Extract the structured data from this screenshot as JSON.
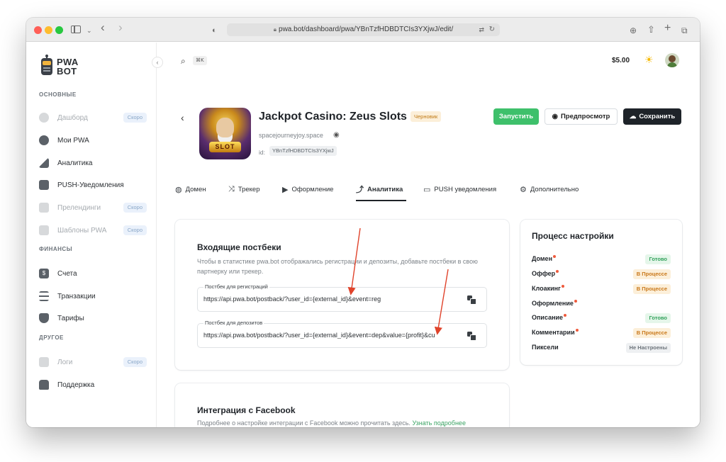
{
  "browser": {
    "url": "pwa.bot/dashboard/pwa/YBnTzfHDBDTCIs3YXjwJ/edit/"
  },
  "sidebar": {
    "logo_text_1": "PWA",
    "logo_text_2": "BOT",
    "sections": [
      {
        "title": "ОСНОВНЫЕ"
      },
      {
        "title": "ФИНАНСЫ"
      },
      {
        "title": "ДРУГОЕ"
      }
    ],
    "items": [
      {
        "label": "Дашборд",
        "badge": "Скоро"
      },
      {
        "label": "Мои PWA"
      },
      {
        "label": "Аналитика"
      },
      {
        "label": "PUSH-Уведомления"
      },
      {
        "label": "Прелендинги",
        "badge": "Скоро"
      },
      {
        "label": "Шаблоны PWA",
        "badge": "Скоро"
      },
      {
        "label": "Счета"
      },
      {
        "label": "Транзакции"
      },
      {
        "label": "Тарифы"
      },
      {
        "label": "Логи",
        "badge": "Скоро"
      },
      {
        "label": "Поддержка"
      }
    ]
  },
  "header": {
    "shortcut": "⌘K",
    "balance": "$5.00"
  },
  "app": {
    "title": "Jackpot Casino: Zeus Slots",
    "status_badge": "Черновик",
    "domain": "spacejourneyjoy.space",
    "id_label": "id:",
    "id_value": "YBnTzfHDBDTCIs3YXjwJ",
    "icon_text": "SLOT"
  },
  "actions": {
    "launch": "Запустить",
    "preview": "Предпросмотр",
    "save": "Сохранить"
  },
  "tabs": [
    {
      "label": "Домен",
      "icon": "globe-icon"
    },
    {
      "label": "Трекер",
      "icon": "shuffle-icon"
    },
    {
      "label": "Оформление",
      "icon": "play-icon"
    },
    {
      "label": "Аналитика",
      "icon": "analytics-icon",
      "active": true
    },
    {
      "label": "PUSH уведомления",
      "icon": "chat-icon"
    },
    {
      "label": "Дополнительно",
      "icon": "gear-icon"
    }
  ],
  "postbacks": {
    "title": "Входящие постбеки",
    "description": "Чтобы в статистике pwa.bot отображались регистрации и депозиты, добавьте постбеки в свою партнерку или трекер.",
    "registration_label": "Постбек для регистраций",
    "registration_value": "https://api.pwa.bot/postback/?user_id={external_id}&event=reg",
    "deposit_label": "Постбек для депозитов",
    "deposit_value": "https://api.pwa.bot/postback/?user_id={external_id}&event=dep&value={profit}&cu"
  },
  "facebook": {
    "title": "Интеграция с Facebook",
    "description": "Подробнее о настройке интеграции с Facebook можно прочитать здесь.",
    "link": "Узнать подробнее"
  },
  "process": {
    "title": "Процесс настройки",
    "rows": [
      {
        "name": "Домен",
        "required": true,
        "status": "Готово",
        "kind": "done"
      },
      {
        "name": "Оффер",
        "required": true,
        "status": "В Процессе",
        "kind": "progress"
      },
      {
        "name": "Клоакинг",
        "required": true,
        "status": "В Процессе",
        "kind": "progress"
      },
      {
        "name": "Оформление",
        "required": true,
        "status": "",
        "kind": ""
      },
      {
        "name": "Описание",
        "required": true,
        "status": "Готово",
        "kind": "done"
      },
      {
        "name": "Комментарии",
        "required": true,
        "status": "В Процессе",
        "kind": "progress"
      },
      {
        "name": "Пиксели",
        "required": false,
        "status": "Не Настроены",
        "kind": "none"
      }
    ]
  },
  "colors": {
    "accent_green": "#3ec06b",
    "dark": "#1e2329",
    "arrow_red": "#e0432b",
    "required_dot": "#ef5a3c"
  }
}
